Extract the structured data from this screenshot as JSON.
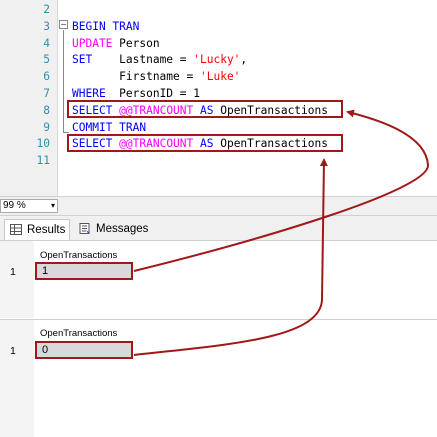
{
  "editor": {
    "lines": [
      {
        "num": "2",
        "tokens": []
      },
      {
        "num": "3",
        "tokens": [
          {
            "t": "BEGIN TRAN",
            "c": "kw"
          }
        ]
      },
      {
        "num": "4",
        "tokens": [
          {
            "t": "UPDATE",
            "c": "fn"
          },
          {
            "t": " Person",
            "c": "pl"
          }
        ]
      },
      {
        "num": "5",
        "tokens": [
          {
            "t": "SET",
            "c": "kw"
          },
          {
            "t": "    Lastname ",
            "c": "pl"
          },
          {
            "t": "=",
            "c": "pl"
          },
          {
            "t": " 'Lucky'",
            "c": "str"
          },
          {
            "t": ",",
            "c": "pl"
          }
        ]
      },
      {
        "num": "6",
        "tokens": [
          {
            "t": "       Firstname ",
            "c": "pl"
          },
          {
            "t": "=",
            "c": "pl"
          },
          {
            "t": " 'Luke'",
            "c": "str"
          }
        ]
      },
      {
        "num": "7",
        "tokens": [
          {
            "t": "WHERE",
            "c": "kw"
          },
          {
            "t": "  PersonID ",
            "c": "pl"
          },
          {
            "t": "=",
            "c": "pl"
          },
          {
            "t": " 1",
            "c": "pl"
          }
        ]
      },
      {
        "num": "8",
        "tokens": [
          {
            "t": "SELECT",
            "c": "kw"
          },
          {
            "t": " ",
            "c": "pl"
          },
          {
            "t": "@@TRANCOUNT",
            "c": "fn"
          },
          {
            "t": " AS",
            "c": "kw"
          },
          {
            "t": " OpenTransactions",
            "c": "pl"
          }
        ]
      },
      {
        "num": "9",
        "tokens": [
          {
            "t": "COMMIT TRAN",
            "c": "kw"
          }
        ]
      },
      {
        "num": "10",
        "tokens": [
          {
            "t": "SELECT",
            "c": "kw"
          },
          {
            "t": " ",
            "c": "pl"
          },
          {
            "t": "@@TRANCOUNT",
            "c": "fn"
          },
          {
            "t": " AS",
            "c": "kw"
          },
          {
            "t": " OpenTransactions",
            "c": "pl"
          }
        ]
      },
      {
        "num": "11",
        "tokens": []
      }
    ],
    "collapse_glyph": "−"
  },
  "zoom": {
    "value": "99 %",
    "arrow": "▾"
  },
  "tabs": {
    "results": "Results",
    "messages": "Messages"
  },
  "grid1": {
    "column": "OpenTransactions",
    "row_num": "1",
    "value": "1"
  },
  "grid2": {
    "column": "OpenTransactions",
    "row_num": "1",
    "value": "0"
  },
  "colors": {
    "highlight": "#a01818",
    "keyword": "#0000ff",
    "function": "#ff00ff",
    "string": "#ff0000",
    "line_number": "#2b91af"
  }
}
